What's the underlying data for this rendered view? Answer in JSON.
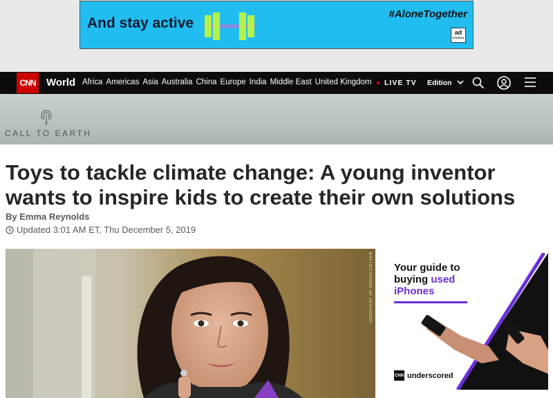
{
  "ad_banner": {
    "headline": "And stay active",
    "hashtag": "#AloneTogether",
    "logo_text": "ad",
    "logo_subtext": "COUNCIL",
    "bg_color": "#21bdf0"
  },
  "navbar": {
    "logo": "CNN",
    "section": "World",
    "links": [
      "Africa",
      "Americas",
      "Asia",
      "Australia",
      "China",
      "Europe",
      "India",
      "Middle East",
      "United Kingdom"
    ],
    "live_tv": "LIVE TV",
    "edition": "Edition",
    "icons": [
      "search-icon",
      "account-icon",
      "menu-icon"
    ],
    "brand_color": "#cc0000"
  },
  "banner": {
    "label": "CALL TO EARTH",
    "icon": "fingerprint-icon"
  },
  "article": {
    "headline": "Toys to tackle climate change: A young inventor wants to inspire kids to create their own solutions",
    "byline": "By Emma Reynolds",
    "updated": "Updated 3:01 AM ET, Thu December 5, 2019",
    "image_credit": "COURTESY OF GIULIA COTTEN"
  },
  "side_ad": {
    "title_line1": "Your guide to",
    "title_line2_prefix": "buying ",
    "title_line2_accent": "used",
    "title_line3": "iPhones",
    "brand_logo": "CNN",
    "brand_name": "underscored",
    "accent_color": "#6a2ed8"
  }
}
